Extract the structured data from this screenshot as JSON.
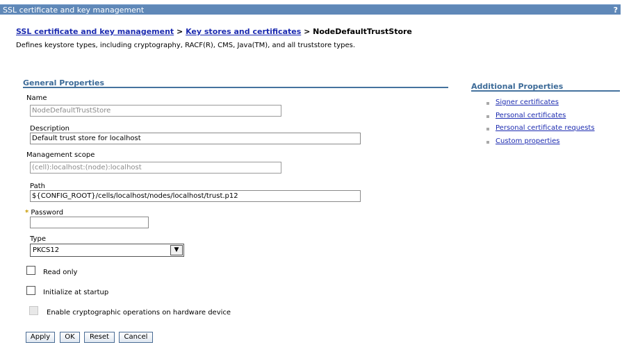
{
  "window": {
    "title": "SSL certificate and key management",
    "help_label": "?"
  },
  "breadcrumb": {
    "link1": "SSL certificate and key management",
    "sep1": " > ",
    "link2": "Key stores and certificates",
    "sep2": " > ",
    "current": "NodeDefaultTrustStore"
  },
  "description": "Defines keystore types, including cryptography, RACF(R), CMS, Java(TM), and all truststore types.",
  "general": {
    "title": "General Properties",
    "name_label": "Name",
    "name_value": "NodeDefaultTrustStore",
    "description_label": "Description",
    "description_value": "Default trust store for localhost",
    "scope_label": "Management scope",
    "scope_value": "(cell):localhost:(node):localhost",
    "path_label": "Path",
    "path_value": "${CONFIG_ROOT}/cells/localhost/nodes/localhost/trust.p12",
    "required_mark": "*",
    "password_label": "Password",
    "password_value": "",
    "type_label": "Type",
    "type_value": "PKCS12",
    "read_only_label": "Read only",
    "read_only_checked": false,
    "init_startup_label": "Initialize at startup",
    "init_startup_checked": false,
    "crypto_label": "Enable cryptographic operations on hardware device",
    "crypto_checked": false
  },
  "buttons": {
    "apply": "Apply",
    "ok": "OK",
    "reset": "Reset",
    "cancel": "Cancel"
  },
  "additional": {
    "title": "Additional Properties",
    "links": [
      "Signer certificates",
      "Personal certificates",
      "Personal certificate requests",
      "Custom properties"
    ]
  },
  "colors": {
    "titlebar": "#5f88b8",
    "section_title": "#3d6b98",
    "link": "#1c2bb0",
    "required": "#c89a00"
  }
}
